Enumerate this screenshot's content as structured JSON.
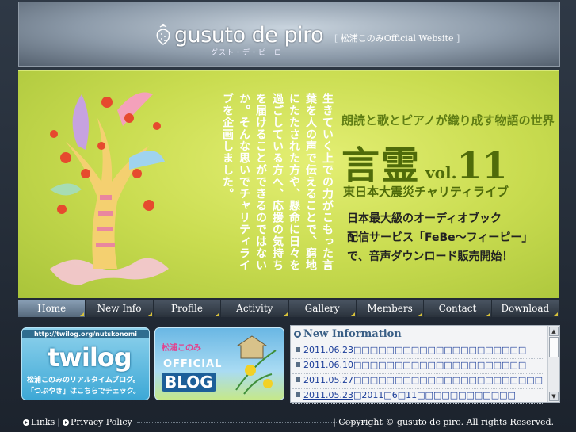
{
  "header": {
    "logo_text": "gusuto de piro",
    "logo_kana": "グスト・デ・ピーロ",
    "subtitle_open": "[",
    "subtitle": "松浦このみOfficial Website",
    "subtitle_close": "]"
  },
  "hero": {
    "vertical_text": "生きていく上での力がこもった言葉を人の声で伝えることで、窮地にたたされた方や、懸命に日々を過ごしている方へ、応援の気持ちを届けることができるのではないか。そんな思いでチャリティライブを企画しました。",
    "catch": "朗読と歌とピアノが織り成す物語の世界",
    "title_main": "言霊",
    "title_vol": "vol.",
    "title_num": "11",
    "charity": "東日本大震災チャリティライブ",
    "febe_line1": "日本最大級のオーディオブック",
    "febe_line2": "配信サービス「FeBe～フィーピー」",
    "febe_line3": "で、音声ダウンロード販売開始！"
  },
  "nav": {
    "items": [
      {
        "label": "Home"
      },
      {
        "label": "New Info"
      },
      {
        "label": "Profile"
      },
      {
        "label": "Activity"
      },
      {
        "label": "Gallery"
      },
      {
        "label": "Members"
      },
      {
        "label": "Contact"
      },
      {
        "label": "Download"
      }
    ]
  },
  "twilog": {
    "url": "http://twilog.org/nutskonomi",
    "logo": "twilog",
    "line1": "松浦このみのリアルタイムブログ。",
    "line2": "「つぶやき」はこちらでチェック。"
  },
  "blog": {
    "name": "松浦このみ",
    "official": "OFFICIAL",
    "blog": "BLOG"
  },
  "news": {
    "heading": "New Information",
    "items": [
      {
        "date": "2011.06.23",
        "text": "□□□□□□□□□□□□□□□□□□□□□"
      },
      {
        "date": "2011.06.10",
        "text": "□□□□□□□□□□□□□□□□□□□□□"
      },
      {
        "date": "2011.05.27",
        "text": "□□□□□□□□□□□□□□□□□□□□□□□□"
      },
      {
        "date": "2011.05.23",
        "text": "□2011□6□11□□□□□□□□□□□□"
      }
    ]
  },
  "footer": {
    "links": "Links",
    "privacy": "Privacy Policy",
    "copyright": "Copyright © gusuto de piro. All rights Reserved."
  },
  "colors": {
    "hero_green": "#c9dc50",
    "title_green": "#4f6b0a",
    "link_blue": "#1b3d99"
  }
}
